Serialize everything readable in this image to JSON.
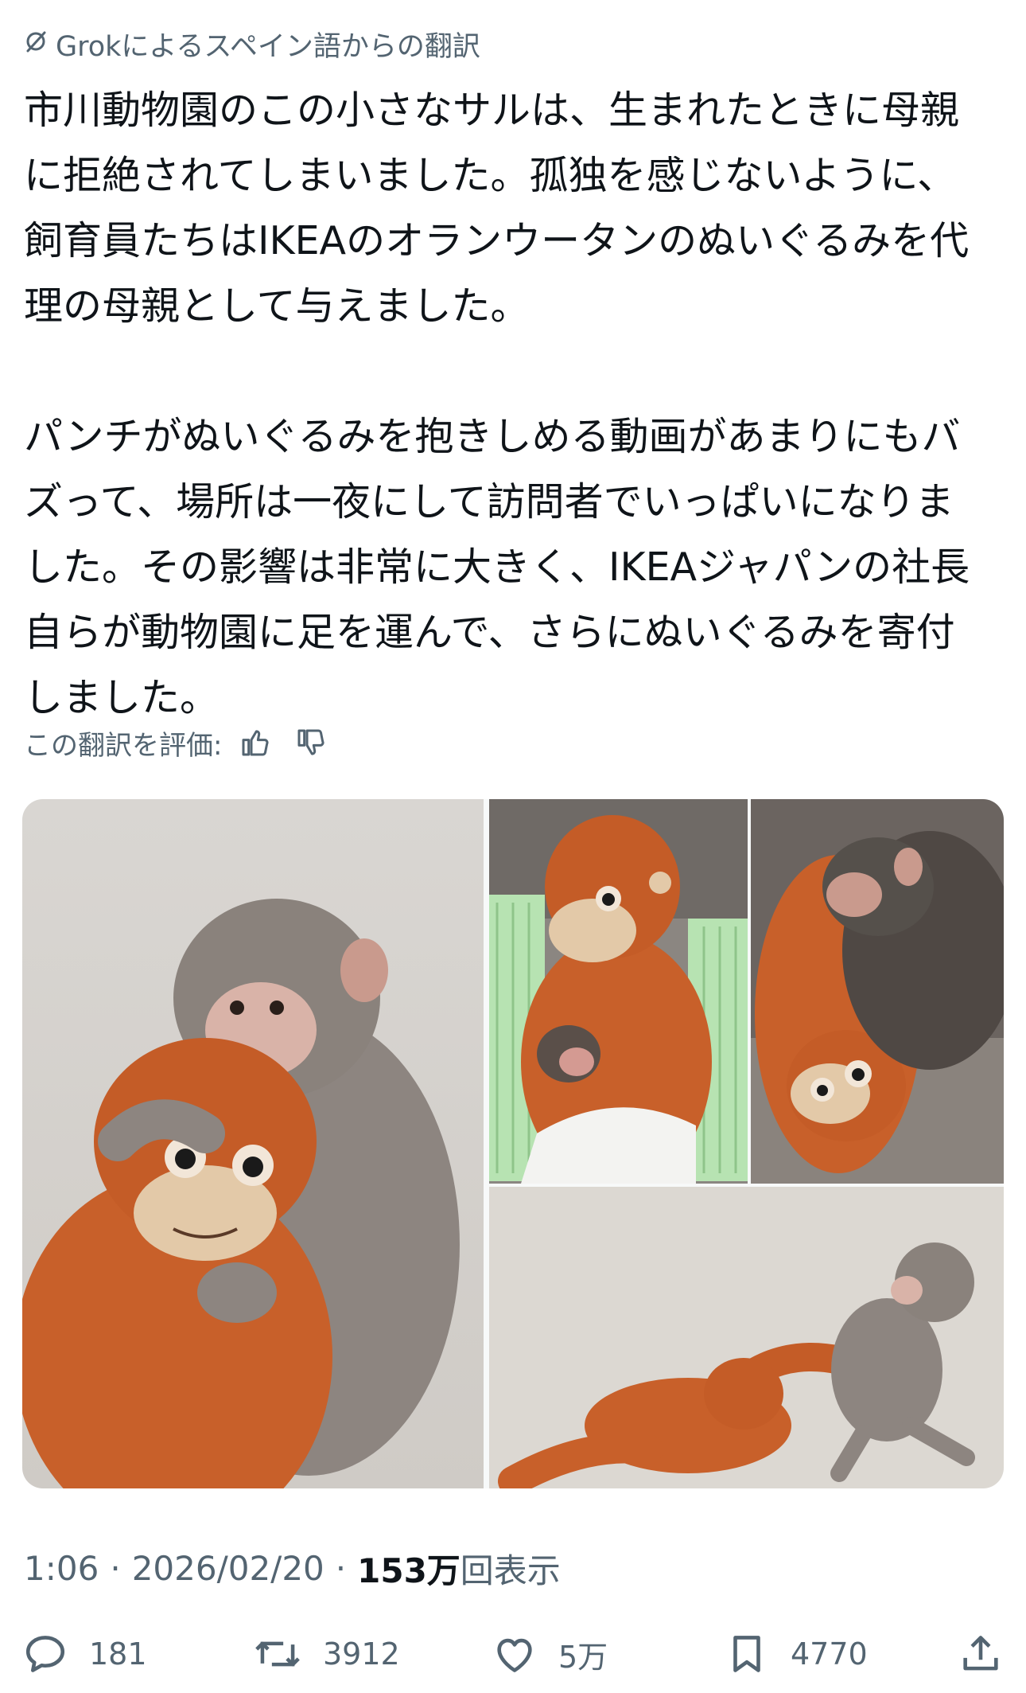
{
  "translation": {
    "icon": "grok-icon",
    "label": "Grokによるスペイン語からの翻訳"
  },
  "post": {
    "paragraphs": [
      "市川動物園のこの小さなサルは、生まれたときに母親\nに拒絶されてしまいました。孤独を感じないように、\n飼育員たちはIKEAのオランウータンのぬいぐるみを代\n理の母親として与えました。",
      "パンチがぬいぐるみを抱きしめる動画があまりにもバ\nズって、場所は一夜にして訪問者でいっぱいになりま\nした。その影響は非常に大きく、IKEAジャパンの社長\n自らが動物園に足を運んで、さらにぬいぐるみを寄付\nしました。"
    ]
  },
  "rating": {
    "label": "この翻訳を評価:",
    "thumbs_up_icon": "thumbs-up-icon",
    "thumbs_down_icon": "thumbs-down-icon"
  },
  "media": {
    "photos": [
      {
        "icon": "photo-monkey-hugging-orangutan-plush"
      },
      {
        "icon": "photo-baby-monkey-in-basket-with-plush"
      },
      {
        "icon": "photo-monkey-sleeping-on-plush"
      },
      {
        "icon": "photo-monkey-dragging-plush"
      }
    ]
  },
  "meta": {
    "time": "1:06",
    "date": "2026/02/20",
    "views": "153万",
    "views_label": "回表示"
  },
  "actions": {
    "reply": {
      "icon": "reply-icon",
      "count": "181"
    },
    "repost": {
      "icon": "repost-icon",
      "count": "3912"
    },
    "like": {
      "icon": "like-icon",
      "count": "5万"
    },
    "bookmark": {
      "icon": "bookmark-icon",
      "count": "4770"
    },
    "share": {
      "icon": "share-icon"
    }
  },
  "colors": {
    "text_primary": "#0f1419",
    "text_secondary": "#536471",
    "plush_orange": "#c8602a"
  }
}
